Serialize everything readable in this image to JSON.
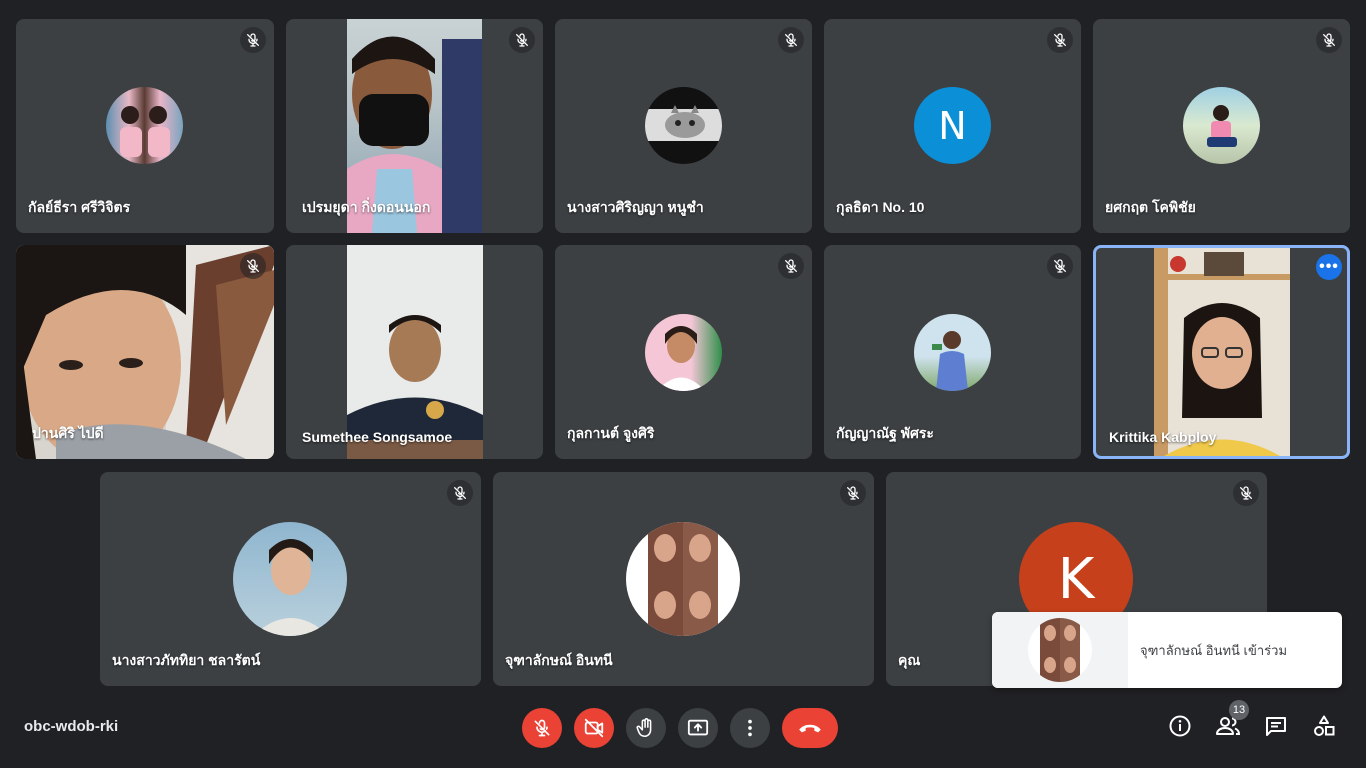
{
  "meeting": {
    "code": "obc-wdob-rki",
    "participant_count": "13"
  },
  "participants": [
    {
      "name": "กัลย์ธีรา ศรีวิจิตร"
    },
    {
      "name": "เปรมยุดา กิ่งดอนนอก"
    },
    {
      "name": "นางสาวศิริญญา หนูชำ"
    },
    {
      "name": "กุลธิดา No. 10",
      "initial": "N",
      "color": "#0b8fd6"
    },
    {
      "name": "ยศกฤต โคพิชัย"
    },
    {
      "name": "ปานศิริ ไปดี"
    },
    {
      "name": "Sumethee Songsamoe"
    },
    {
      "name": "กุลกานต์ จูงศิริ"
    },
    {
      "name": "กัญญาณัฐ พัศระ"
    },
    {
      "name": "Krittika Kabploy"
    },
    {
      "name": "นางสาวภัททิยา ชลารัตน์"
    },
    {
      "name": "จุฑาลักษณ์ อินทนี"
    },
    {
      "name": "คุณ",
      "initial": "K",
      "color": "#c6411b"
    }
  ],
  "toast": {
    "message": "จุฑาลักษณ์ อินทนี เข้าร่วม"
  },
  "colors": {
    "background": "#202124",
    "tile": "#3c4043",
    "red": "#ea4335",
    "active_border": "#8ab4f8"
  },
  "icons": [
    "mic-off-icon",
    "camera-off-icon",
    "raise-hand-icon",
    "present-screen-icon",
    "more-options-icon",
    "end-call-icon",
    "info-icon",
    "people-icon",
    "chat-icon",
    "activities-icon"
  ]
}
